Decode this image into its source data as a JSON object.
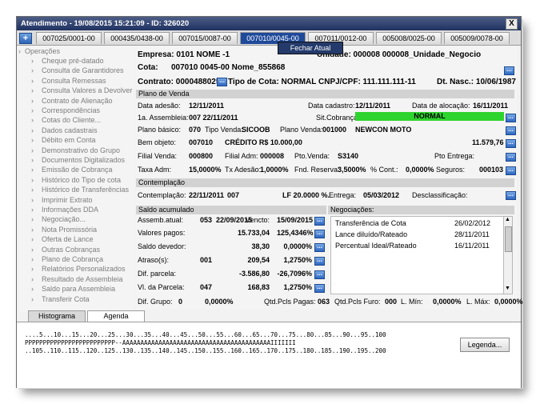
{
  "window": {
    "title": "Atendimento - 19/08/2015  15:21:09 - ID: 326020",
    "close_label": "X",
    "add_label": "+"
  },
  "tabs": [
    {
      "label": "007025/0001-00"
    },
    {
      "label": "000435/0438-00"
    },
    {
      "label": "007015/0087-00"
    },
    {
      "label": "007010/0045-00"
    },
    {
      "label": "007011/0012-00"
    },
    {
      "label": "005008/0025-00"
    },
    {
      "label": "005009/0078-00"
    }
  ],
  "popup_menu": {
    "item": "Fechar Atual"
  },
  "menu": {
    "root": "Operações",
    "items": [
      "Cheque pré-datado",
      "Consulta de Garantidores",
      "Consulta Remessas",
      "Consulta Valores a Devolver",
      "Contrato de Alienação",
      "Correspondências",
      "Cotas do Cliente...",
      "Dados cadastrais",
      "Débito em Conta",
      "Demonstrativo do Grupo",
      "Documentos Digitalizados",
      "Emissão de Cobrança",
      "Histórico do Tipo de cota",
      "Histórico de Transferências",
      "Imprimir Extrato",
      "Informações DDA",
      "Negociação...",
      "Nota Promissória",
      "Oferta de Lance",
      "Outras Cobranças",
      "Plano de Cobrança",
      "Relatórios Personalizados",
      "Resultado de Assembleia",
      "Saldo para Assembleia",
      "Transferir Cota"
    ]
  },
  "header": {
    "empresa": "Empresa: 0101 NOME -1",
    "unidade": "Unidade: 000008 000008_Unidade_Negocio",
    "cota_label": "Cota:",
    "cota_value": "007010  0045-00  Nome_855868",
    "contrato": "Contrato: 0000488025",
    "tipo_cota": "Tipo de Cota: NORMAL",
    "cnpj": "CNPJ/CPF: 111.111.111-11",
    "nasc": "Dt. Nasc.: 10/06/1987"
  },
  "plano": {
    "section": "Plano de Venda",
    "data_adesao_l": "Data adesão:",
    "data_adesao_v": "12/11/2011",
    "data_cadastro_l": "Data cadastro:",
    "data_cadastro_v": "12/11/2011",
    "data_alocacao_l": "Data de alocação:",
    "data_alocacao_v": "16/11/2011",
    "assembleia_l": "1a. Assembleia:",
    "assembleia_v": "007  22/11/2011",
    "sit_l": "Sit.Cobrança:",
    "sit_v": "NORMAL",
    "plano_basico_l": "Plano básico:",
    "plano_basico_v": "070",
    "tipo_venda_l": "Tipo Venda:",
    "tipo_venda_v": "SICOOB",
    "plano_venda_l": "Plano Venda:",
    "plano_venda_v": "001000",
    "plano_venda_nome": "NEWCON MOTO",
    "bem_l": "Bem objeto:",
    "bem_v": "007010",
    "bem_desc": "CRÉDITO R$ 10.000,00",
    "bem_valor": "11.579,76",
    "filial_venda_l": "Filial Venda:",
    "filial_venda_v": "000800",
    "filial_adm_l": "Filial Adm:",
    "filial_adm_v": "000008",
    "pto_venda_l": "Pto.Venda:",
    "pto_venda_v": "S3140",
    "pto_entrega_l": "Pto Entrega:",
    "taxa_adm_l": "Taxa Adm:",
    "taxa_adm_v": "15,0000%",
    "tx_adesao_l": "Tx Adesão:",
    "tx_adesao_v": "1,0000%",
    "fnd_reserva_l": "Fnd. Reserva:",
    "fnd_reserva_v": "3,5000%",
    "pct_cont_l": "% Cont.:",
    "pct_cont_v": "0,0000%",
    "seguros_l": "Seguros:",
    "seguros_v": "000103"
  },
  "contemplacao": {
    "section": "Contemplação",
    "label": "Contemplação:",
    "date": "22/11/2011",
    "num": "007",
    "lf": "LF 20.0000 %.",
    "entrega_l": "Entrega:",
    "entrega_v": "05/03/2012",
    "descl_l": "Desclassificação:"
  },
  "saldo": {
    "section": "Saldo acumulado",
    "rows": [
      {
        "label": "Assemb.atual:",
        "a": "053",
        "b": "22/09/2015",
        "c": "Vencto:",
        "d": "15/09/2015"
      },
      {
        "label": "Valores pagos:",
        "a": "",
        "b": "",
        "c": "15.733,04",
        "d": "125,4346%"
      },
      {
        "label": "Saldo devedor:",
        "a": "",
        "b": "",
        "c": "38,30",
        "d": "0,0000%"
      },
      {
        "label": "Atraso(s):",
        "a": "001",
        "b": "",
        "c": "209,54",
        "d": "1,2750%"
      },
      {
        "label": "Dif. parcela:",
        "a": "",
        "b": "",
        "c": "-3.586,80",
        "d": "-26,7096%"
      },
      {
        "label": "Vl. da Parcela:",
        "a": "047",
        "b": "",
        "c": "168,83",
        "d": "1,2750%"
      }
    ]
  },
  "negociacoes": {
    "section": "Negociações:",
    "rows": [
      {
        "label": "Transferência de Cota",
        "date": "26/02/2012"
      },
      {
        "label": "Lance diluído/Rateado",
        "date": "28/11/2011"
      },
      {
        "label": "Percentual Ideal/Rateado",
        "date": "16/11/2011"
      }
    ]
  },
  "footer_row": {
    "dif_grupo_l": "Dif. Grupo:",
    "dif_grupo_a": "0",
    "dif_grupo_b": "0,0000%",
    "qtd_pagas_l": "Qtd.Pcls Pagas:",
    "qtd_pagas_v": "063",
    "qtd_furo_l": "Qtd.Pcls Furo:",
    "qtd_furo_v": "000",
    "lmin_l": "L. Mín:",
    "lmin_v": "0,0000%",
    "lmax_l": "L. Máx:",
    "lmax_v": "0,0000%"
  },
  "bottom_tabs": [
    "Histograma",
    "Agenda"
  ],
  "histogram": {
    "line1": "....5...10...15...20...25...30...35...40...45...50...55...60...65...70...75...80...85...90...95..100",
    "line2": "PPPPPPPPPPPPPPPPPPPPPPPPP--AAAAAAAAAAAAAAAAAAAAAAAAAAAAAAAAAAAAAAAAAIIIIIII",
    "line3": "..105..110..115..120..125..130..135..140..145..150..155..160..165..170..175..180..185..190..195..200",
    "legend_button": "Legenda..."
  },
  "colors": {
    "title_bar": "#1f3160",
    "active_tab": "#1f4a9a",
    "status_normal": "#2ed42e",
    "dots_button": "#2f68c2"
  }
}
